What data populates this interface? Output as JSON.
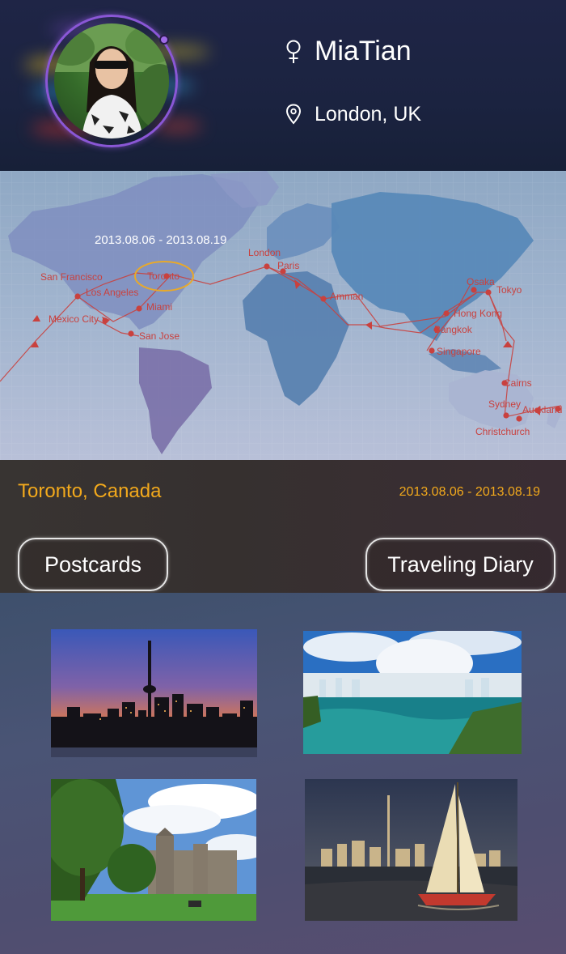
{
  "profile": {
    "name": "MiaTian",
    "location": "London, UK",
    "gender_icon": "female-icon",
    "location_icon": "map-pin-icon",
    "ring_color": "#8a57d6"
  },
  "map": {
    "date_range": "2013.08.06 - 2013.08.19",
    "highlight_color": "#e8a92a",
    "route_color": "#c9413e",
    "cities": {
      "san_francisco": "San Francisco",
      "toronto": "Toronto",
      "los_angeles": "Los Angeles",
      "miami": "Miami",
      "mexico_city": "Mexico City",
      "san_jose": "San Jose",
      "london": "London",
      "paris": "Paris",
      "amman": "Amman",
      "osaka": "Osaka",
      "tokyo": "Tokyo",
      "hong_kong": "Hong Kong",
      "bangkok": "Bangkok",
      "singapore": "Singapore",
      "cairns": "Cairns",
      "sydney": "Sydney",
      "auckland": "Auckland",
      "christchurch": "Christchurch"
    }
  },
  "trip": {
    "city": "Toronto, Canada",
    "date_range": "2013.08.06 - 2013.08.19",
    "accent_color": "#f2a91c",
    "postcards_label": "Postcards",
    "diary_label": "Traveling Diary"
  },
  "gallery": {
    "photos": [
      "toronto-skyline-dusk",
      "niagara-falls",
      "university-campus",
      "sailboat-skyline"
    ]
  }
}
